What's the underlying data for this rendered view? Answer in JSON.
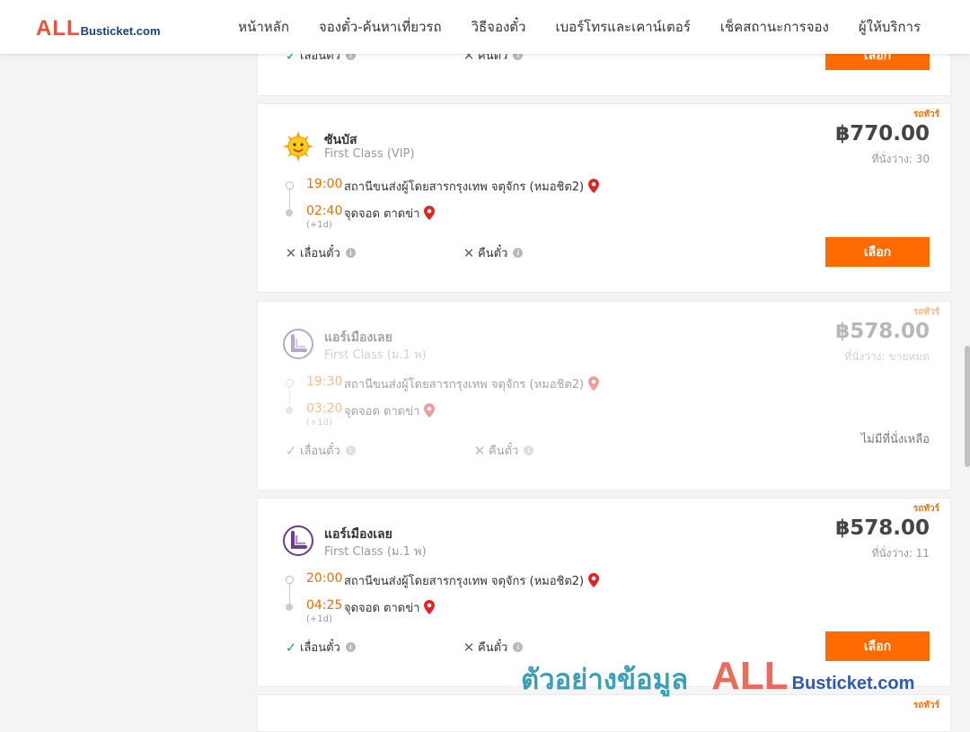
{
  "header": {
    "logo_main": "ALL",
    "logo_rest": "Busticket.com",
    "nav": [
      "หน้าหลัก",
      "จองตั๋ว-ค้นหาเที่ยวรถ",
      "วิธีจองตั๋ว",
      "เบอร์โทรและเคาน์เตอร์",
      "เช็คสถานะการจอง",
      "ผู้ให้บริการ"
    ]
  },
  "partial_card": {
    "reschedule_label": "เลื่อนตั๋ว",
    "refund_label": "คืนตั๋ว",
    "select_label": "เลือก"
  },
  "trips": [
    {
      "tag": "รถทัวร์",
      "operator": "ซันบัส",
      "class": "First Class (VIP)",
      "price": "฿770.00",
      "seats": "ที่นั่งว่าง: 30",
      "dep_time": "19:00",
      "dep_place": "สถานีขนส่งผู้โดยสารกรุงเทพ จตุจักร (หมอชิต2)",
      "arr_time": "02:40",
      "arr_place": "จุดจอด ตาดข่า",
      "next_day": "(+1d)",
      "reschedule": "เลื่อนตั๋ว",
      "refund": "คืนตั๋ว",
      "action": "เลือก"
    },
    {
      "tag": "รถทัวร์",
      "operator": "แอร์เมืองเลย",
      "class": "First Class (ม.1 พ)",
      "price": "฿578.00",
      "seats": "ที่นั่งว่าง: ขายหมด",
      "dep_time": "19:30",
      "dep_place": "สถานีขนส่งผู้โดยสารกรุงเทพ จตุจักร (หมอชิต2)",
      "arr_time": "03:20",
      "arr_place": "จุดจอด ตาดข่า",
      "next_day": "(+1d)",
      "reschedule": "เลื่อนตั๋ว",
      "refund": "คืนตั๋ว",
      "action": "ไม่มีที่นั่งเหลือ"
    },
    {
      "tag": "รถทัวร์",
      "operator": "แอร์เมืองเลย",
      "class": "First Class (ม.1 พ)",
      "price": "฿578.00",
      "seats": "ที่นั่งว่าง: 11",
      "dep_time": "20:00",
      "dep_place": "สถานีขนส่งผู้โดยสารกรุงเทพ จตุจักร (หมอชิต2)",
      "arr_time": "04:25",
      "arr_place": "จุดจอด ตาดข่า",
      "next_day": "(+1d)",
      "reschedule": "เลื่อนตั๋ว",
      "refund": "คืนตั๋ว",
      "action": "เลือก"
    }
  ],
  "bottom_card": {
    "tag": "รถทัวร์"
  },
  "watermark": {
    "thai": "ตัวอย่างข้อมูล",
    "all": "ALL",
    "rest": "Busticket.com"
  },
  "colors": {
    "accent": "#ff6b00",
    "logo_red": "#e8533e",
    "logo_blue": "#1f3f7a"
  }
}
